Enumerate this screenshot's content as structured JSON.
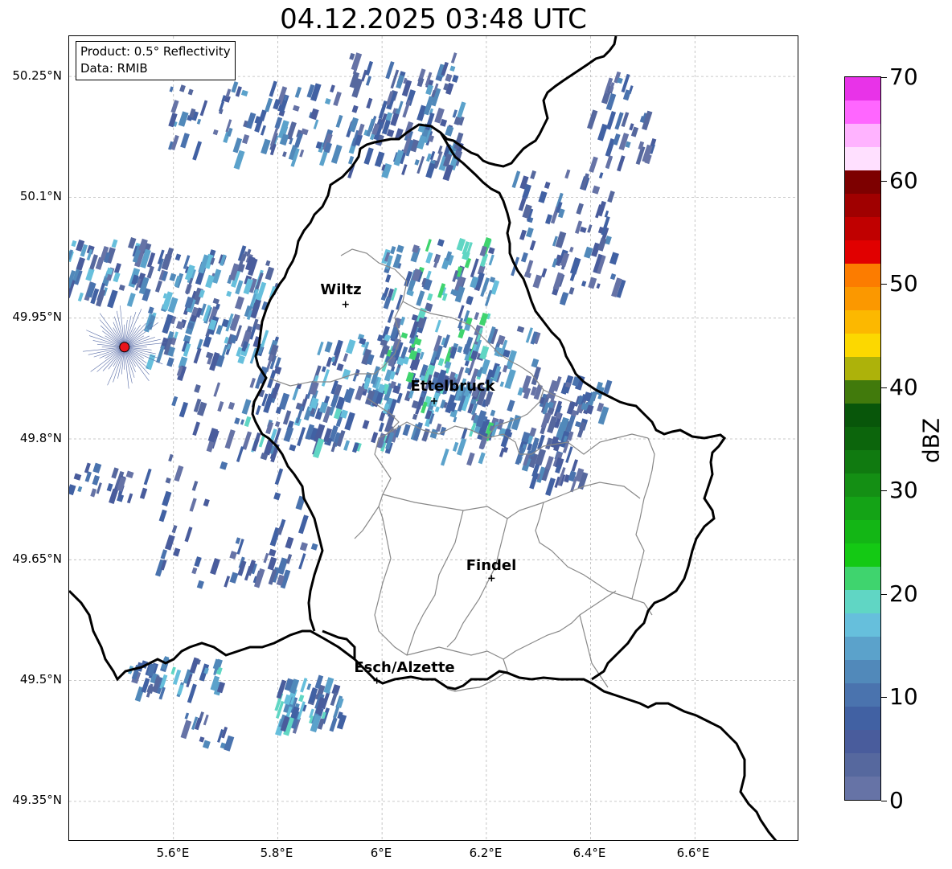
{
  "title": "04.12.2025 03:48 UTC",
  "info_box": {
    "line1": "Product: 0.5° Reflectivity",
    "line2": "Data: RMIB"
  },
  "map": {
    "lat_range": [
      49.3,
      50.3
    ],
    "lon_range": [
      5.4,
      6.8
    ],
    "lat_ticks": [
      {
        "value": 50.25,
        "label": "50.25°N"
      },
      {
        "value": 50.1,
        "label": "50.1°N"
      },
      {
        "value": 49.95,
        "label": "49.95°N"
      },
      {
        "value": 49.8,
        "label": "49.8°N"
      },
      {
        "value": 49.65,
        "label": "49.65°N"
      },
      {
        "value": 49.5,
        "label": "49.5°N"
      },
      {
        "value": 49.35,
        "label": "49.35°N"
      }
    ],
    "lon_ticks": [
      {
        "value": 5.6,
        "label": "5.6°E"
      },
      {
        "value": 5.8,
        "label": "5.8°E"
      },
      {
        "value": 6.0,
        "label": "6°E"
      },
      {
        "value": 6.2,
        "label": "6.2°E"
      },
      {
        "value": 6.4,
        "label": "6.4°E"
      },
      {
        "value": 6.6,
        "label": "6.6°E"
      }
    ],
    "cities": [
      {
        "name": "Wiltz",
        "lon": 5.93,
        "lat": 49.967
      },
      {
        "name": "Ettelbruck",
        "lon": 6.1,
        "lat": 49.847
      },
      {
        "name": "Findel",
        "lon": 6.21,
        "lat": 49.627
      },
      {
        "name": "Esch/Alzette",
        "lon": 5.99,
        "lat": 49.5
      }
    ],
    "radar_site": {
      "lon": 5.506,
      "lat": 49.914,
      "color": "#e8141b"
    }
  },
  "colorbar": {
    "unit": "dBZ",
    "min": 0,
    "max": 70,
    "ticks": [
      "0",
      "10",
      "20",
      "30",
      "40",
      "50",
      "60",
      "70"
    ],
    "colors": [
      "#6673a6",
      "#56689e",
      "#495c9c",
      "#4161a3",
      "#4a73ae",
      "#5189ba",
      "#5ba2cb",
      "#66bfdc",
      "#60d6c4",
      "#3fd46e",
      "#14c914",
      "#13b615",
      "#14a316",
      "#148f14",
      "#107a10",
      "#0c650c",
      "#08560a",
      "#417a0c",
      "#adb20a",
      "#fcd800",
      "#fcb800",
      "#fb9800",
      "#fc7c00",
      "#e10000",
      "#c00000",
      "#a00000",
      "#7d0000",
      "#ffe0ff",
      "#ffb3ff",
      "#ff66ff",
      "#e833e8"
    ]
  }
}
